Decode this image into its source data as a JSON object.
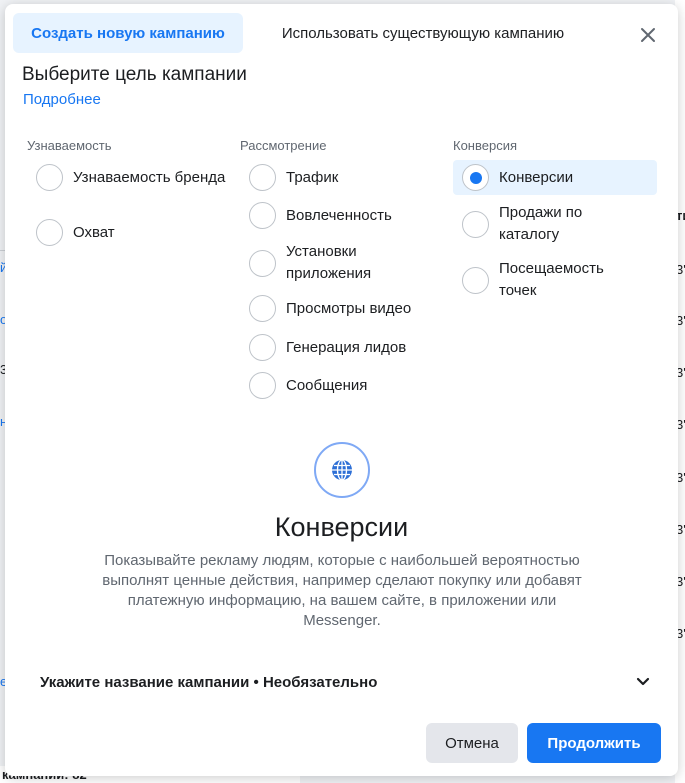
{
  "background": {
    "right_glyphs": [
      "ти",
      "3'",
      "3'",
      "3'",
      "3'",
      "3'",
      "3'",
      "3'",
      "3'"
    ],
    "left_glyphs": [
      "й",
      "о",
      "3",
      "н",
      "е"
    ],
    "bottom_text": "кампании: 82"
  },
  "tabs": {
    "create": "Создать новую кампанию",
    "existing": "Использовать существующую кампанию"
  },
  "heading": "Выберите цель кампании",
  "more_link": "Подробнее",
  "columns": {
    "awareness": {
      "label": "Узнаваемость",
      "options": [
        "Узнаваемость бренда",
        "Охват"
      ]
    },
    "consideration": {
      "label": "Рассмотрение",
      "options": [
        "Трафик",
        "Вовлеченность",
        "Установки приложения",
        "Просмотры видео",
        "Генерация лидов",
        "Сообщения"
      ]
    },
    "conversion": {
      "label": "Конверсия",
      "options": [
        "Конверсии",
        "Продажи по каталогу",
        "Посещаемость точек"
      ]
    }
  },
  "selected_option": "Конверсии",
  "detail": {
    "icon": "globe-icon",
    "title": "Конверсии",
    "description": "Показывайте рекламу людям, которые с наибольшей вероятностью выполнят ценные действия, например сделают покупку или добавят платежную информацию, на вашем сайте, в приложении или Messenger."
  },
  "campaign_name": {
    "label": "Укажите название кампании • Необязательно",
    "icon": "chevron-down-icon"
  },
  "buttons": {
    "cancel": "Отмена",
    "continue": "Продолжить"
  },
  "colors": {
    "accent": "#1877f2",
    "selected_bg": "#e7f3ff"
  }
}
